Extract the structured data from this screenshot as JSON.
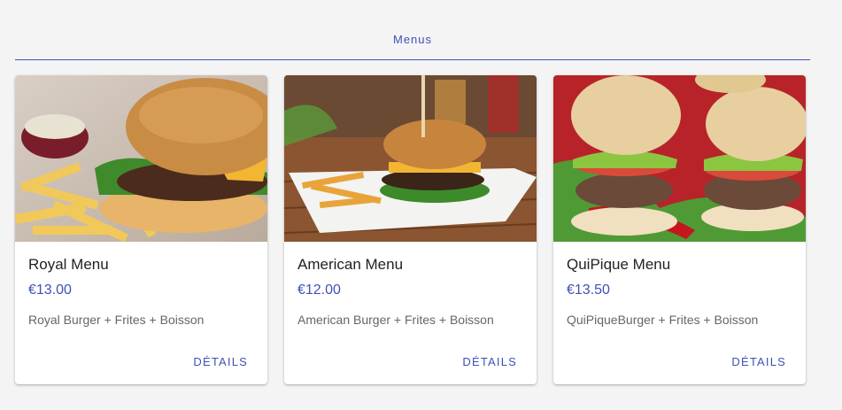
{
  "section": {
    "title": "Menus"
  },
  "colors": {
    "accent": "#3f51b5",
    "background": "#f4f4f4",
    "card": "#ffffff"
  },
  "cards": [
    {
      "title": "Royal Menu",
      "price": "€13.00",
      "description": "Royal Burger + Frites + Boisson",
      "action": "DÉTAILS"
    },
    {
      "title": "American Menu",
      "price": "€12.00",
      "description": "American Burger + Frites + Boisson",
      "action": "DÉTAILS"
    },
    {
      "title": "QuiPique Menu",
      "price": "€13.50",
      "description": "QuiPiqueBurger + Frites + Boisson",
      "action": "DÉTAILS"
    }
  ]
}
